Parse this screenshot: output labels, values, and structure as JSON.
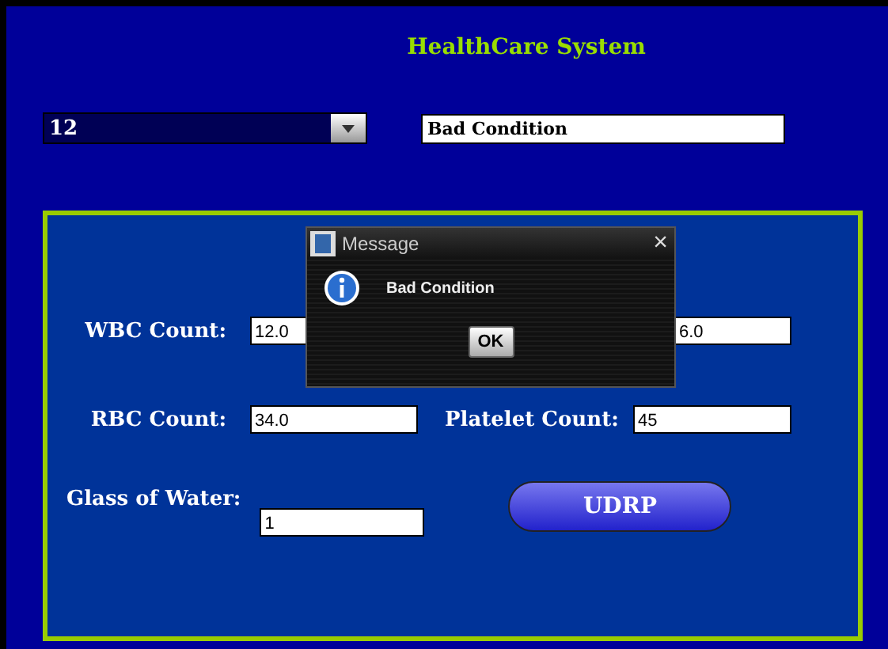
{
  "title": "HealthCare System",
  "patient_select": {
    "value": "12"
  },
  "condition_field": {
    "value": "Bad Condition"
  },
  "form": {
    "fields": [
      {
        "label": "WBC Count:",
        "value": "12.0"
      },
      {
        "label": "RBC Count:",
        "value": "34.0"
      },
      {
        "label": "Platelet Count:",
        "value": "45"
      },
      {
        "label": "Glass of Water:",
        "value": "1"
      }
    ],
    "hidden_field": {
      "value": "6.0"
    },
    "button": "UDRP"
  },
  "dialog": {
    "title": "Message",
    "close": "×",
    "message": "Bad Condition",
    "button": "OK"
  }
}
